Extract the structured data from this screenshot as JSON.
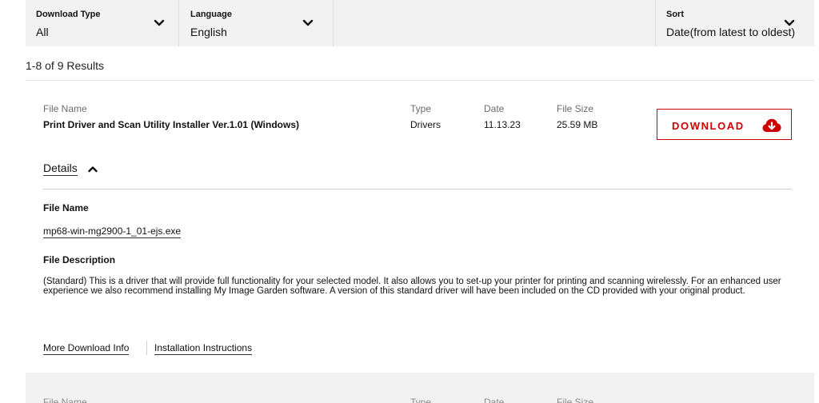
{
  "filters": {
    "download_type": {
      "label": "Download Type",
      "value": "All"
    },
    "language": {
      "label": "Language",
      "value": "English"
    },
    "sort": {
      "label": "Sort",
      "value": "Date(from latest to oldest)"
    }
  },
  "results_count": "1-8 of 9 Results",
  "result": {
    "headers": {
      "file_name": "File Name",
      "type": "Type",
      "date": "Date",
      "file_size": "File Size"
    },
    "file_name": "Print Driver and Scan Utility Installer Ver.1.01 (Windows)",
    "type": "Drivers",
    "date": "11.13.23",
    "file_size": "25.59 MB",
    "download_label": "DOWNLOAD",
    "details_label": "Details",
    "details": {
      "file_name_heading": "File Name",
      "file_name": "mp68-win-mg2900-1_01-ejs.exe",
      "description_heading": "File Description",
      "description": "(Standard) This is a driver that will provide full functionality for your selected model. It also allows you to set-up your printer for printing and scanning wirelessly. For an enhanced user experience we also recommend installing My Image Garden software. A version of this standard driver will have been included on the CD provided with your original product."
    },
    "links": {
      "more_info": "More Download Info",
      "installation": "Installation Instructions"
    }
  },
  "next_result": {
    "headers": {
      "file_name": "File Name",
      "type": "Type",
      "date": "Date",
      "file_size": "File Size"
    }
  },
  "colors": {
    "accent": "#cc0000",
    "panel": "#f2f2f2",
    "divider": "#e3e3e3"
  },
  "icons": {
    "dropdown": "chevron-down-icon",
    "download": "cloud-download-icon",
    "collapse": "chevron-up-icon"
  }
}
